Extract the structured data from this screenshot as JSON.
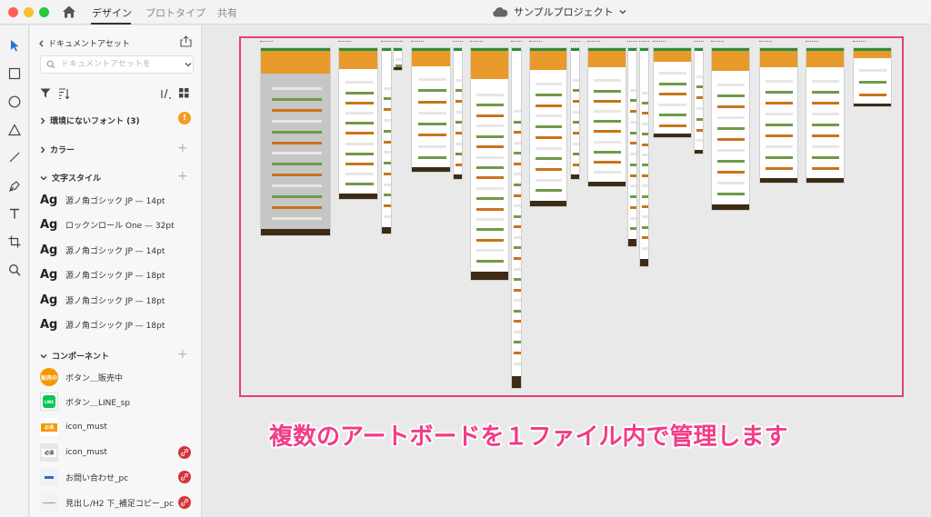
{
  "titlebar": {
    "tabs": [
      "デザイン",
      "プロトタイプ",
      "共有"
    ],
    "project_name": "サンプルプロジェクト"
  },
  "tools": [
    "select-tool",
    "rectangle-tool",
    "ellipse-tool",
    "polygon-tool",
    "line-tool",
    "pen-tool",
    "text-tool",
    "artboard-tool",
    "zoom-tool"
  ],
  "panel": {
    "title": "ドキュメントアセット",
    "search_placeholder": "ドキュメントアセットを",
    "sections": {
      "missing_fonts": "環境にないフォント (3)",
      "warning": "!",
      "colors": "カラー",
      "text_styles": "文字スタイル",
      "components": "コンポーネント"
    },
    "text_styles": [
      {
        "sample": "Ag",
        "label": "源ノ角ゴシック JP — 14pt"
      },
      {
        "sample": "Ag",
        "label": "ロックンロール One — 32pt"
      },
      {
        "sample": "Ag",
        "label": "源ノ角ゴシック JP — 14pt"
      },
      {
        "sample": "Ag",
        "label": "源ノ角ゴシック JP — 18pt"
      },
      {
        "sample": "Ag",
        "label": "源ノ角ゴシック JP — 18pt"
      },
      {
        "sample": "Ag",
        "label": "源ノ角ゴシック JP — 18pt"
      }
    ],
    "components": [
      {
        "label": "ボタン＿販売中",
        "thumb_text": "販売中",
        "thumb_color": "#f39800"
      },
      {
        "label": "ボタン＿LINE_sp",
        "thumb_text": "LINE",
        "thumb_color": "#06c755"
      },
      {
        "label": "icon_must",
        "thumb_text": "必須",
        "thumb_color": "#f39800"
      },
      {
        "label": "icon_must",
        "thumb_text": "必須",
        "thumb_color": "#333333"
      },
      {
        "label": "お問い合わせ_pc",
        "thumb_text": "",
        "thumb_color": "#2f6db5"
      },
      {
        "label": "見出し/H2 下_補足コピー_pc",
        "thumb_text": "",
        "thumb_color": "#999999"
      }
    ]
  },
  "canvas": {
    "caption": "複数のアートボードを１ファイル内で管理します",
    "colors": {
      "selection": "#e5406e",
      "caption": "#f23b87",
      "orange": "#f0a020",
      "brown": "#3d2b16",
      "green": "#2e8b3a"
    }
  }
}
